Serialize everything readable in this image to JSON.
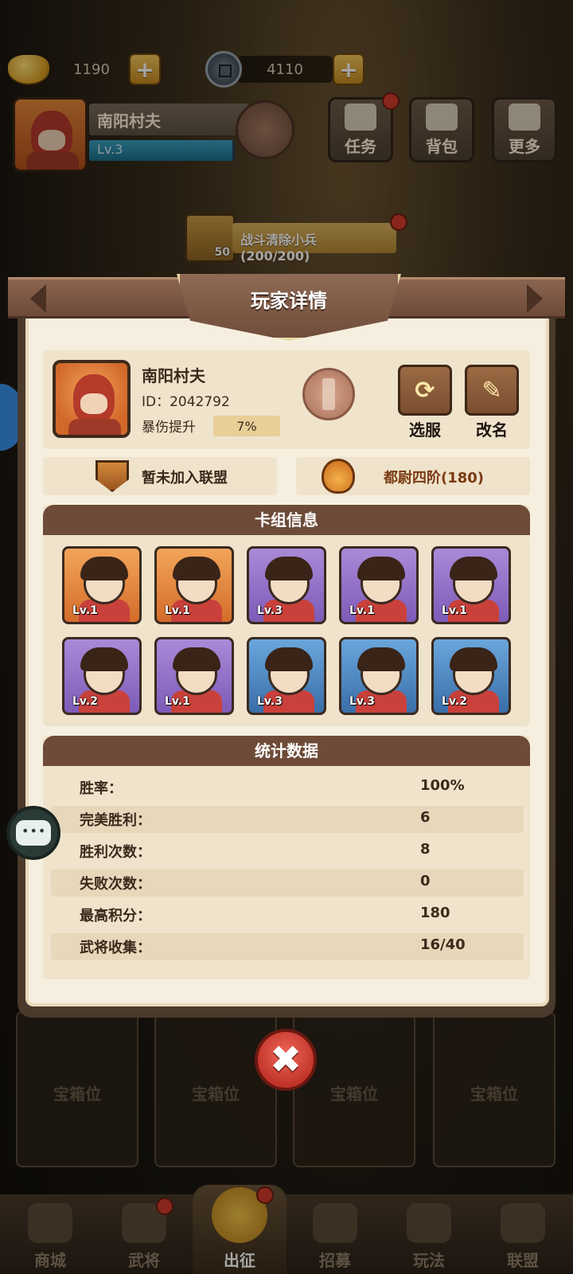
{
  "hud": {
    "gold": "1190",
    "coins": "4110",
    "player_name": "南阳村夫",
    "player_level": "Lv.3",
    "level_progress": 0.98,
    "menu": {
      "tasks": "任务",
      "bag": "背包",
      "more": "更多"
    },
    "quest": {
      "reward": "50",
      "text": "战斗清除小兵 (200/200)"
    }
  },
  "modal": {
    "title": "玩家详情",
    "profile": {
      "name": "南阳村夫",
      "id": "ID：2042792",
      "crit_label": "暴伤提升",
      "crit_value": "7%",
      "switch_server": "选服",
      "rename": "改名"
    },
    "alliance_status": "暂未加入联盟",
    "rank_text": "都尉四阶(180)",
    "deck": {
      "title": "卡组信息",
      "cards": [
        {
          "level": "Lv.1",
          "frame": "orange"
        },
        {
          "level": "Lv.1",
          "frame": "orange"
        },
        {
          "level": "Lv.3",
          "frame": "purple"
        },
        {
          "level": "Lv.1",
          "frame": "purple"
        },
        {
          "level": "Lv.1",
          "frame": "purple"
        },
        {
          "level": "Lv.2",
          "frame": "purple"
        },
        {
          "level": "Lv.1",
          "frame": "purple"
        },
        {
          "level": "Lv.3",
          "frame": "blue"
        },
        {
          "level": "Lv.3",
          "frame": "blue"
        },
        {
          "level": "Lv.2",
          "frame": "blue"
        }
      ]
    },
    "stats": {
      "title": "统计数据",
      "rows": [
        {
          "label": "胜率：",
          "value": "100%"
        },
        {
          "label": "完美胜利：",
          "value": "6"
        },
        {
          "label": "胜利次数：",
          "value": "8"
        },
        {
          "label": "失败次数：",
          "value": "0"
        },
        {
          "label": "最高积分：",
          "value": "180"
        },
        {
          "label": "武将收集：",
          "value": "16/40"
        }
      ]
    },
    "close_symbol": "✖"
  },
  "chests": [
    "宝箱位",
    "宝箱位",
    "宝箱位",
    "宝箱位"
  ],
  "nav": [
    "商城",
    "武将",
    "出征",
    "招募",
    "玩法",
    "联盟"
  ],
  "colors": {
    "modal_bg": "#f6efdf",
    "header_brown": "#6d4b38",
    "close_red": "#c1342a",
    "rank_text": "#7a3a12"
  }
}
